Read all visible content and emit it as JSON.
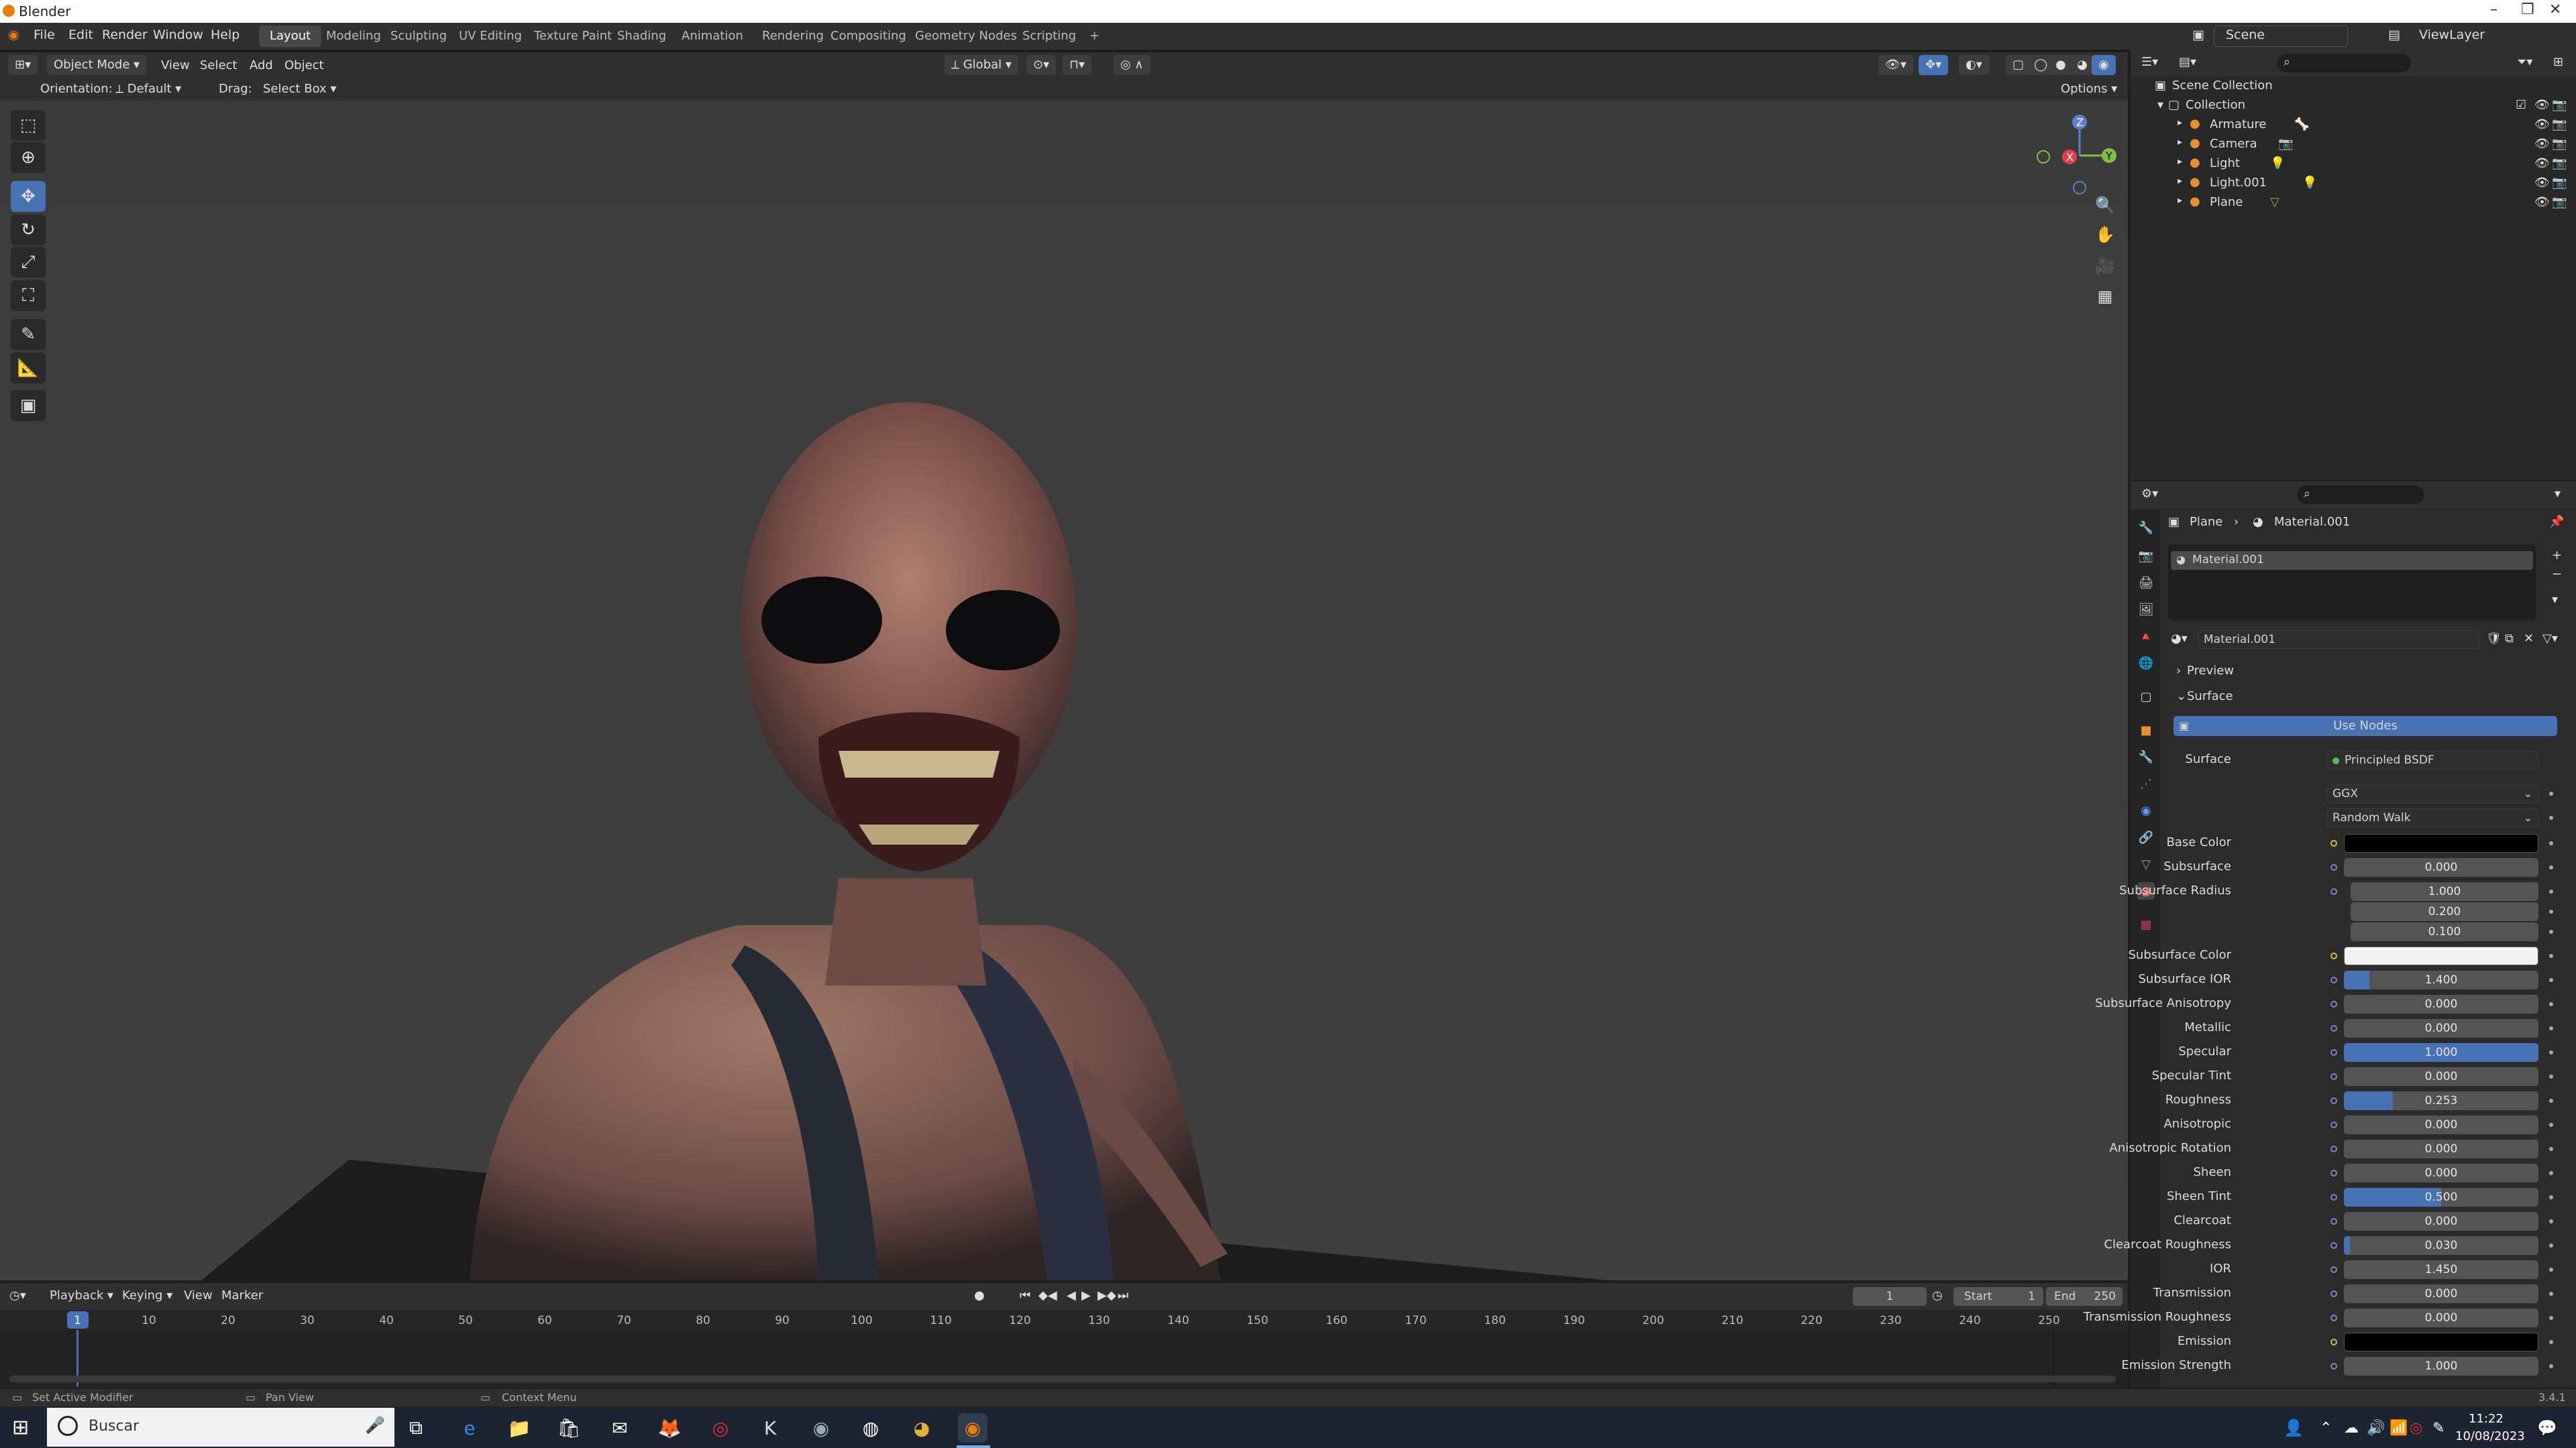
{
  "title_bar": {
    "title": "Blender",
    "minimize": "–",
    "maximize": "❐",
    "close": "✕"
  },
  "menus": [
    "File",
    "Edit",
    "Render",
    "Window",
    "Help"
  ],
  "workspaces": [
    "Layout",
    "Modeling",
    "Sculpting",
    "UV Editing",
    "Texture Paint",
    "Shading",
    "Animation",
    "Rendering",
    "Compositing",
    "Geometry Nodes",
    "Scripting",
    "+"
  ],
  "active_workspace": "Layout",
  "scene": {
    "label": "Scene",
    "view_layer": "ViewLayer"
  },
  "viewport_header": {
    "mode": "Object Mode",
    "view": "View",
    "select": "Select",
    "add": "Add",
    "object": "Object",
    "transform": "Global",
    "options": "Options",
    "orientation_label": "Orientation:",
    "orientation_value": "Default",
    "drag_label": "Drag:",
    "drag_value": "Select Box"
  },
  "gizmo": {
    "x": "X",
    "y": "Y",
    "z": "Z"
  },
  "outliner": {
    "scene_collection": "Scene Collection",
    "collection": "Collection",
    "items": [
      "Armature",
      "Camera",
      "Light",
      "Light.001",
      "Plane"
    ]
  },
  "properties": {
    "breadcrumb_object": "Plane",
    "breadcrumb_material": "Material.001",
    "slot": "Material.001",
    "material_name": "Material.001",
    "preview": "Preview",
    "surface_panel": "Surface",
    "use_nodes": "Use Nodes",
    "surface_label": "Surface",
    "surface_value": "Principled BSDF",
    "distribution": "GGX",
    "subsurface_method": "Random Walk",
    "fields": [
      {
        "label": "Base Color",
        "value": "",
        "color": "#000000"
      },
      {
        "label": "Subsurface",
        "value": "0.000",
        "fill": 0
      },
      {
        "label": "Subsurface Radius",
        "value": "1.000",
        "fill": 0
      },
      {
        "label": "",
        "value": "0.200",
        "fill": 0
      },
      {
        "label": "",
        "value": "0.100",
        "fill": 0
      },
      {
        "label": "Subsurface Color",
        "value": "",
        "color": "#f2f2f2"
      },
      {
        "label": "Subsurface IOR",
        "value": "1.400",
        "fill": 0.13
      },
      {
        "label": "Subsurface Anisotropy",
        "value": "0.000",
        "fill": 0
      },
      {
        "label": "Metallic",
        "value": "0.000",
        "fill": 0
      },
      {
        "label": "Specular",
        "value": "1.000",
        "fill": 1
      },
      {
        "label": "Specular Tint",
        "value": "0.000",
        "fill": 0
      },
      {
        "label": "Roughness",
        "value": "0.253",
        "fill": 0.253
      },
      {
        "label": "Anisotropic",
        "value": "0.000",
        "fill": 0
      },
      {
        "label": "Anisotropic Rotation",
        "value": "0.000",
        "fill": 0
      },
      {
        "label": "Sheen",
        "value": "0.000",
        "fill": 0
      },
      {
        "label": "Sheen Tint",
        "value": "0.500",
        "fill": 0.5
      },
      {
        "label": "Clearcoat",
        "value": "0.000",
        "fill": 0
      },
      {
        "label": "Clearcoat Roughness",
        "value": "0.030",
        "fill": 0.03
      },
      {
        "label": "IOR",
        "value": "1.450",
        "fill": 0
      },
      {
        "label": "Transmission",
        "value": "0.000",
        "fill": 0
      },
      {
        "label": "Transmission Roughness",
        "value": "0.000",
        "fill": 0
      },
      {
        "label": "Emission",
        "value": "",
        "color": "#000000"
      },
      {
        "label": "Emission Strength",
        "value": "1.000",
        "fill": 0
      }
    ]
  },
  "timeline": {
    "playback": "Playback",
    "keying": "Keying",
    "view": "View",
    "marker": "Marker",
    "current_frame": "1",
    "start_label": "Start",
    "start": "1",
    "end_label": "End",
    "end": "250",
    "ticks": [
      "1",
      "10",
      "20",
      "30",
      "40",
      "50",
      "60",
      "70",
      "80",
      "90",
      "100",
      "110",
      "120",
      "130",
      "140",
      "150",
      "160",
      "170",
      "180",
      "190",
      "200",
      "210",
      "220",
      "230",
      "240",
      "250"
    ]
  },
  "status_bar": {
    "left": "Set Active Modifier",
    "middle": "Pan View",
    "right": "Context Menu",
    "version": "3.4.1"
  },
  "taskbar": {
    "search": "Buscar",
    "time": "11:22",
    "date": "10/08/2023"
  }
}
